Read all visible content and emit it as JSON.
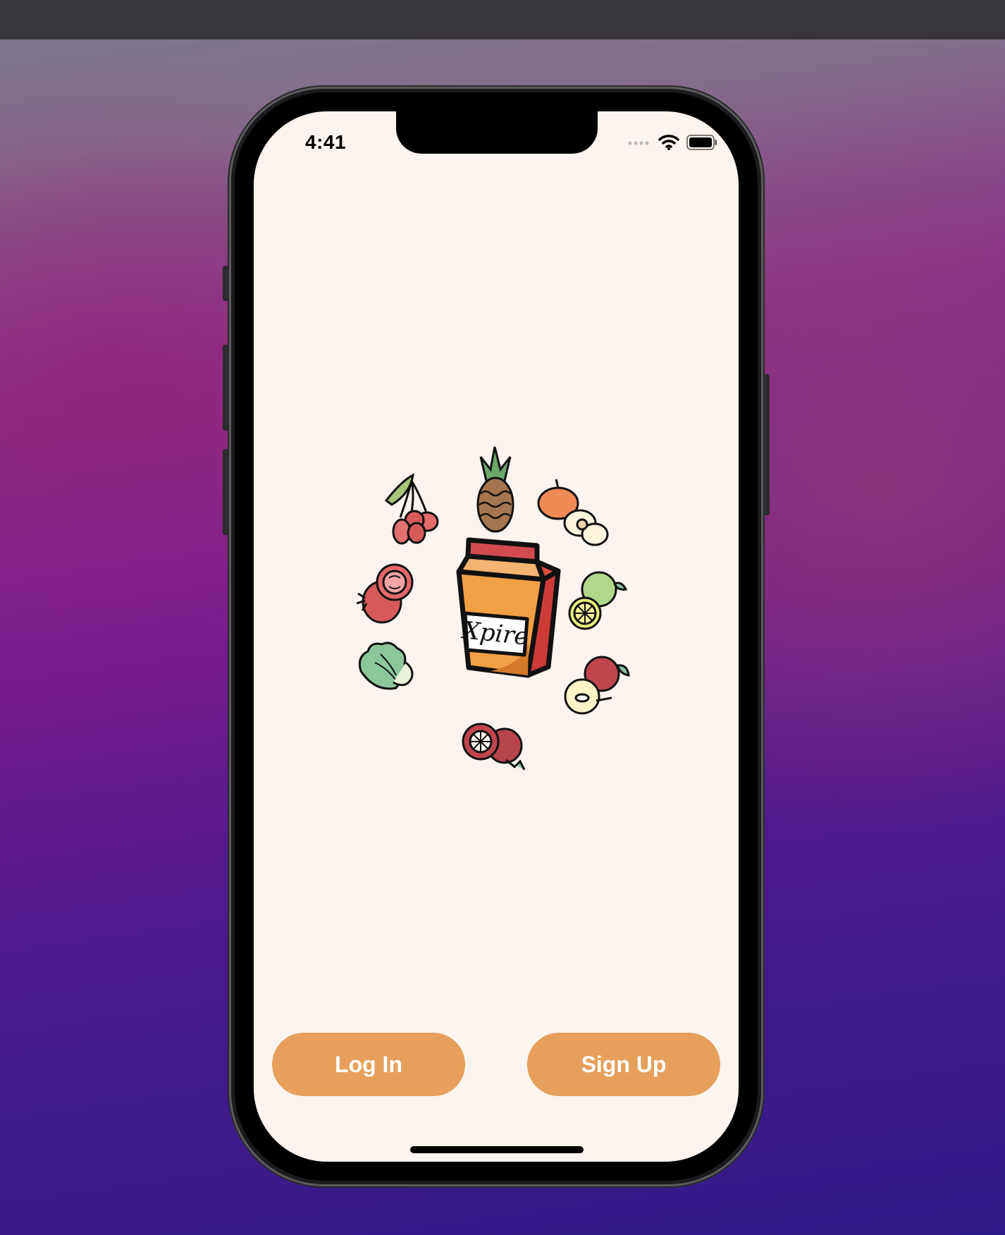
{
  "status_bar": {
    "time": "4:41"
  },
  "logo": {
    "brand_text": "Xpire"
  },
  "buttons": {
    "login_label": "Log In",
    "signup_label": "Sign Up"
  }
}
